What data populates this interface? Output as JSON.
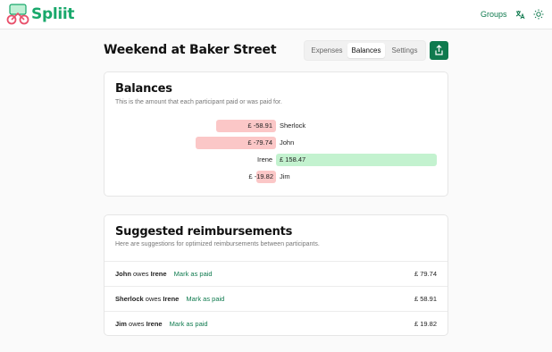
{
  "app": {
    "name": "Spliit",
    "brand_color": "#18a86b",
    "accent_color": "#0f7a4e"
  },
  "nav": {
    "groups_label": "Groups",
    "icons": [
      "language-icon",
      "theme-sun-icon"
    ]
  },
  "group": {
    "title": "Weekend at Baker Street"
  },
  "tabs": [
    {
      "label": "Expenses",
      "active": false
    },
    {
      "label": "Balances",
      "active": true
    },
    {
      "label": "Settings",
      "active": false
    }
  ],
  "balances": {
    "title": "Balances",
    "subtitle": "This is the amount that each participant paid or was paid for.",
    "currency": "£",
    "items": [
      {
        "name": "Sherlock",
        "display": "£ -58.91",
        "amount": -58.91
      },
      {
        "name": "John",
        "display": "£ -79.74",
        "amount": -79.74
      },
      {
        "name": "Irene",
        "display": "£ 158.47",
        "amount": 158.47
      },
      {
        "name": "Jim",
        "display": "£ -19.82",
        "amount": -19.82
      }
    ]
  },
  "reimbursements": {
    "title": "Suggested reimbursements",
    "subtitle": "Here are suggestions for optimized reimbursements between participants.",
    "owes_word": "owes",
    "mark_label": "Mark as paid",
    "items": [
      {
        "from": "John",
        "to": "Irene",
        "amount": "£ 79.74"
      },
      {
        "from": "Sherlock",
        "to": "Irene",
        "amount": "£ 58.91"
      },
      {
        "from": "Jim",
        "to": "Irene",
        "amount": "£ 19.82"
      }
    ]
  }
}
